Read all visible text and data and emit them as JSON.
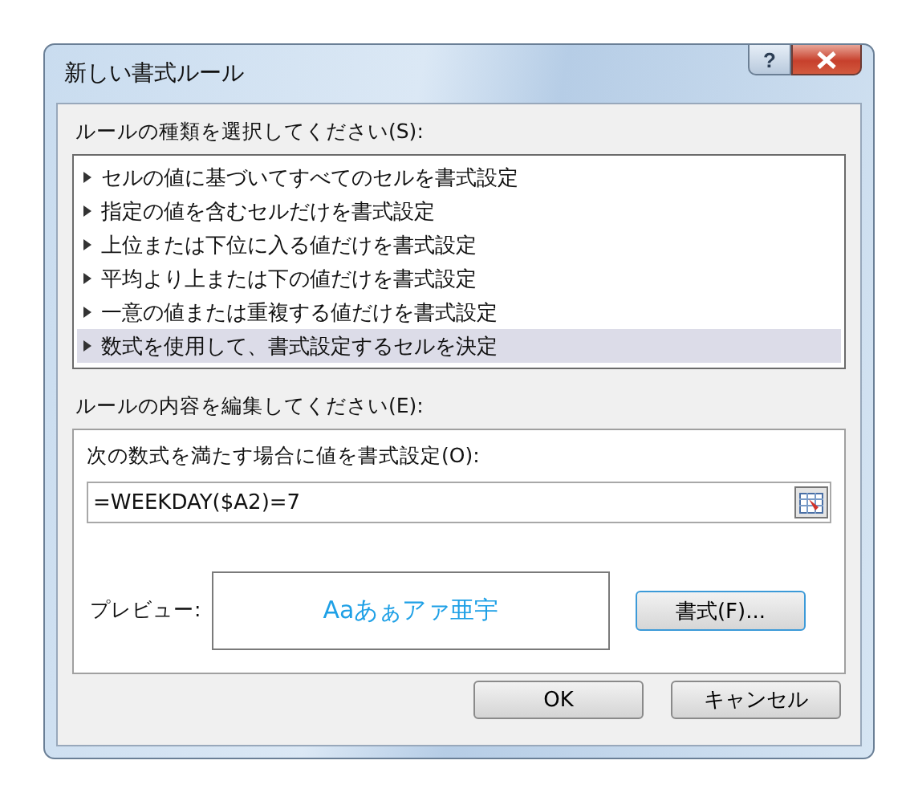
{
  "window": {
    "title": "新しい書式ルール",
    "help": "?"
  },
  "rule_type": {
    "label": "ルールの種類を選択してください(S):",
    "items": [
      {
        "label": "セルの値に基づいてすべてのセルを書式設定",
        "selected": false
      },
      {
        "label": "指定の値を含むセルだけを書式設定",
        "selected": false
      },
      {
        "label": "上位または下位に入る値だけを書式設定",
        "selected": false
      },
      {
        "label": "平均より上または下の値だけを書式設定",
        "selected": false
      },
      {
        "label": "一意の値または重複する値だけを書式設定",
        "selected": false
      },
      {
        "label": "数式を使用して、書式設定するセルを決定",
        "selected": true
      }
    ]
  },
  "rule_edit": {
    "label": "ルールの内容を編集してください(E):",
    "formula_label": "次の数式を満たす場合に値を書式設定(O):",
    "formula": "=WEEKDAY($A2)=7",
    "preview_label": "プレビュー:",
    "preview_text": "Aaあぁアァ亜宇",
    "format_button": "書式(F)..."
  },
  "buttons": [
    "OK",
    "キャンセル"
  ]
}
